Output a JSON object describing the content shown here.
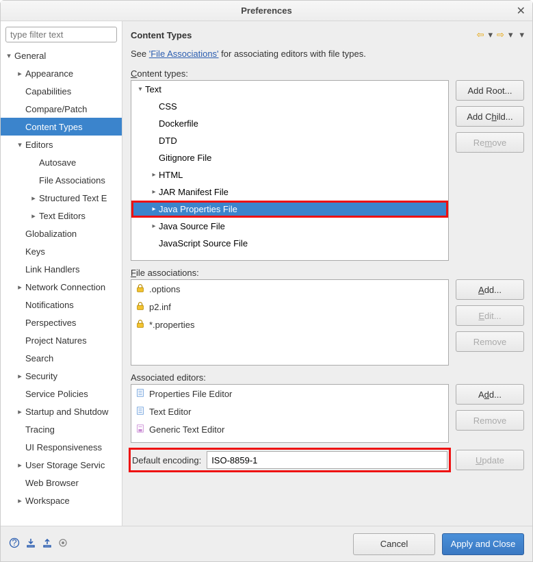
{
  "window": {
    "title": "Preferences"
  },
  "filter": {
    "placeholder": "type filter text"
  },
  "sidebar": {
    "items": [
      {
        "label": "General",
        "level": 0,
        "arrow": "▾"
      },
      {
        "label": "Appearance",
        "level": 1,
        "arrow": "▸"
      },
      {
        "label": "Capabilities",
        "level": 1,
        "arrow": ""
      },
      {
        "label": "Compare/Patch",
        "level": 1,
        "arrow": ""
      },
      {
        "label": "Content Types",
        "level": 1,
        "arrow": "",
        "selected": true
      },
      {
        "label": "Editors",
        "level": 1,
        "arrow": "▾"
      },
      {
        "label": "Autosave",
        "level": 2,
        "arrow": ""
      },
      {
        "label": "File Associations",
        "level": 2,
        "arrow": ""
      },
      {
        "label": "Structured Text E",
        "level": 2,
        "arrow": "▸"
      },
      {
        "label": "Text Editors",
        "level": 2,
        "arrow": "▸"
      },
      {
        "label": "Globalization",
        "level": 1,
        "arrow": ""
      },
      {
        "label": "Keys",
        "level": 1,
        "arrow": ""
      },
      {
        "label": "Link Handlers",
        "level": 1,
        "arrow": ""
      },
      {
        "label": "Network Connection",
        "level": 1,
        "arrow": "▸"
      },
      {
        "label": "Notifications",
        "level": 1,
        "arrow": ""
      },
      {
        "label": "Perspectives",
        "level": 1,
        "arrow": ""
      },
      {
        "label": "Project Natures",
        "level": 1,
        "arrow": ""
      },
      {
        "label": "Search",
        "level": 1,
        "arrow": ""
      },
      {
        "label": "Security",
        "level": 1,
        "arrow": "▸"
      },
      {
        "label": "Service Policies",
        "level": 1,
        "arrow": ""
      },
      {
        "label": "Startup and Shutdow",
        "level": 1,
        "arrow": "▸"
      },
      {
        "label": "Tracing",
        "level": 1,
        "arrow": ""
      },
      {
        "label": "UI Responsiveness",
        "level": 1,
        "arrow": ""
      },
      {
        "label": "User Storage Servic",
        "level": 1,
        "arrow": "▸"
      },
      {
        "label": "Web Browser",
        "level": 1,
        "arrow": ""
      },
      {
        "label": "Workspace",
        "level": 1,
        "arrow": "▸"
      }
    ]
  },
  "page": {
    "title": "Content Types",
    "hint_prefix": "See ",
    "hint_link": "'File Associations'",
    "hint_suffix": " for associating editors with file types.",
    "content_types_label": "Content types:",
    "file_assoc_label": "File associations:",
    "assoc_editors_label": "Associated editors:",
    "default_encoding_label": "Default encoding:",
    "default_encoding_value": "ISO-8859-1"
  },
  "content_types": [
    {
      "label": "Text",
      "arrow": "▾",
      "indent": 0
    },
    {
      "label": "CSS",
      "arrow": "",
      "indent": 1
    },
    {
      "label": "Dockerfile",
      "arrow": "",
      "indent": 1
    },
    {
      "label": "DTD",
      "arrow": "",
      "indent": 1
    },
    {
      "label": "Gitignore File",
      "arrow": "",
      "indent": 1
    },
    {
      "label": "HTML",
      "arrow": "▸",
      "indent": 1
    },
    {
      "label": "JAR Manifest File",
      "arrow": "▸",
      "indent": 1
    },
    {
      "label": "Java Properties File",
      "arrow": "▸",
      "indent": 1,
      "selected": true
    },
    {
      "label": "Java Source File",
      "arrow": "▸",
      "indent": 1
    },
    {
      "label": "JavaScript Source File",
      "arrow": "",
      "indent": 1
    }
  ],
  "ct_buttons": {
    "add_root": "Add Root...",
    "add_child": "Add Child...",
    "remove": "Remove"
  },
  "file_associations": [
    {
      "label": ".options",
      "locked": true
    },
    {
      "label": "p2.inf",
      "locked": true
    },
    {
      "label": "*.properties",
      "locked": true
    }
  ],
  "fa_buttons": {
    "add": "Add...",
    "edit": "Edit...",
    "remove": "Remove"
  },
  "associated_editors": [
    {
      "label": "Properties File Editor",
      "icon": "doc"
    },
    {
      "label": "Text Editor",
      "icon": "doc"
    },
    {
      "label": "Generic Text Editor",
      "icon": "gdoc"
    }
  ],
  "ae_buttons": {
    "add": "Add...",
    "remove": "Remove"
  },
  "update_button": "Update",
  "footer": {
    "cancel": "Cancel",
    "apply": "Apply and Close"
  }
}
